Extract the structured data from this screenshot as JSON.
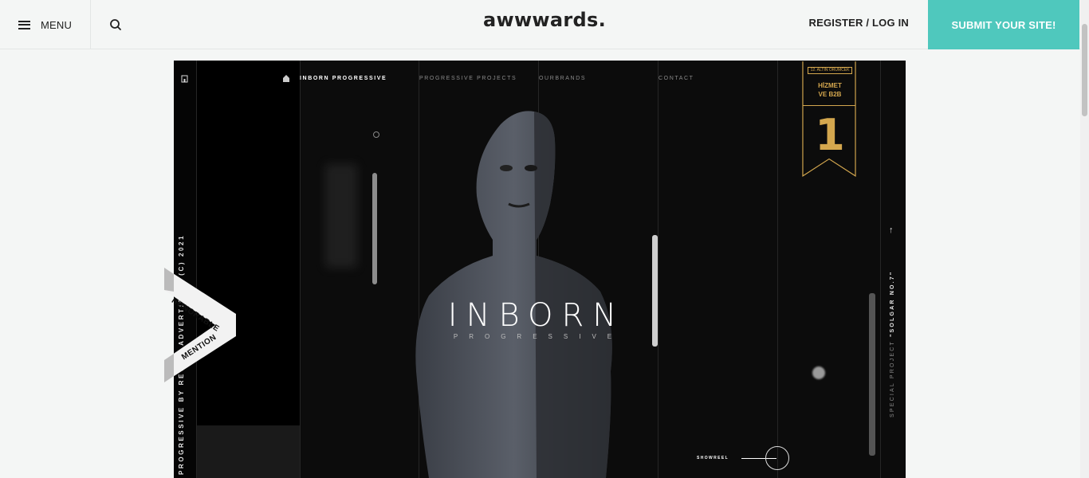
{
  "header": {
    "menu_label": "MENU",
    "logo": "awwwards.",
    "login_label": "REGISTER / LOG IN",
    "submit_label": "SUBMIT YOUR SITE!",
    "accent_color": "#4fc8bd"
  },
  "preview": {
    "nav": {
      "home": "INBORN PROGRESSIVE",
      "projects": "PROGRESSIVE PROJECTS",
      "brands": "OURBRANDS",
      "contact": "CONTACT"
    },
    "brand_title": "INBORN",
    "brand_subtitle": "PROGRESSIVE",
    "side_left_text": "PROGRESSIVE BY REVIVE ADVERTISING (C) 2021",
    "side_right_prefix": "SPECIAL PROJECT ",
    "side_right_bold": "\"SOLGAR NO.7\"",
    "award_badge": {
      "top": "12. ALTIN ÖRÜMCEK",
      "line1": "HİZMET",
      "line2": "VE B2B",
      "rank": "1",
      "color": "#d4a74e"
    },
    "showreel_label": "SHOWREEL"
  },
  "ribbon": {
    "line1": "HONORABLE",
    "line2": "MENTION"
  }
}
